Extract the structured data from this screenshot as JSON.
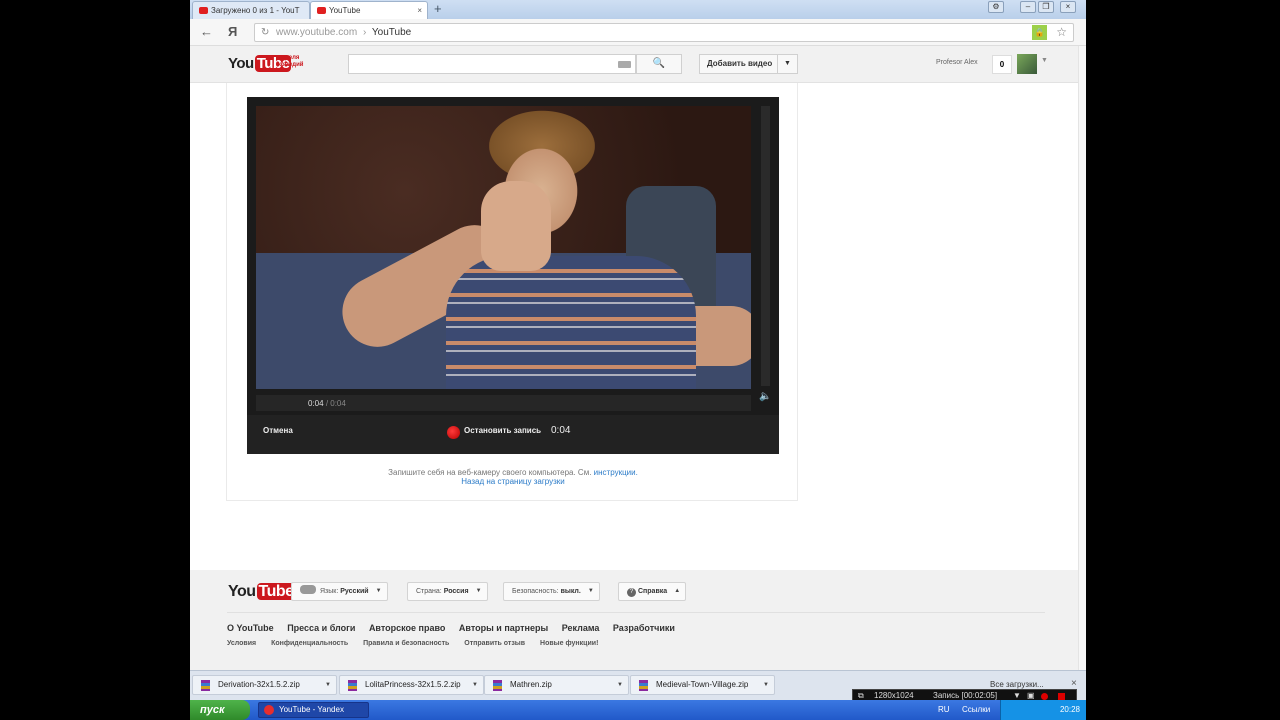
{
  "browser": {
    "tabs": [
      {
        "label": "Загружено 0 из 1 - YouT",
        "active": false
      },
      {
        "label": "YouTube",
        "active": true
      }
    ],
    "url_domain": "www.youtube.com",
    "url_separator": "›",
    "page_title": "YouTube"
  },
  "header": {
    "logo_you": "You",
    "logo_tube": "Tube",
    "logo_subtitle_line1": "неделя",
    "logo_subtitle_line2": "комедий",
    "search_placeholder": "",
    "add_video_label": "Добавить видео",
    "username": "Profesor Alex",
    "notifications_count": "0"
  },
  "recorder_player": {
    "current_time": "0:04",
    "duration": "/ 0:04",
    "cancel_label": "Отмена",
    "stop_label": "Остановить запись",
    "rec_time": "0:04"
  },
  "caption": {
    "text": "Запишите себя на веб-камеру своего компьютера. См. ",
    "instructions_link": "инструкции.",
    "back_link": "Назад на страницу загрузки"
  },
  "footer": {
    "logo_you": "You",
    "logo_tube": "Tube",
    "language_label": "Язык:",
    "language_value": "Русский",
    "country_label": "Страна:",
    "country_value": "Россия",
    "safety_label": "Безопасность:",
    "safety_value": "выкл.",
    "help_label": "Справка",
    "links": [
      "О YouTube",
      "Пресса и блоги",
      "Авторское право",
      "Авторы и партнеры",
      "Реклама",
      "Разработчики"
    ],
    "links_secondary": [
      "Условия",
      "Конфиденциальность",
      "Правила и безопасность",
      "Отправить отзыв",
      "Новые функции!"
    ]
  },
  "downloads": {
    "items": [
      "Derivation-32x1.5.2.zip",
      "LolitaPrincess-32x1.5.2.zip",
      "Mathren.zip",
      "Medieval-Town-Village.zip"
    ],
    "all_label": "Все загрузки..."
  },
  "screen_recorder": {
    "resolution": "1280x1024",
    "status": "Запись [00:02:05]"
  },
  "taskbar": {
    "start_label": "пуск",
    "active_task": "YouTube - Yandex",
    "language": "RU",
    "links_label": "Ссылки",
    "clock": "20:28"
  },
  "icons": {
    "back": "back-arrow-icon",
    "yandex": "yandex-icon",
    "reload": "reload-icon",
    "lock": "lock-icon",
    "star": "star-icon",
    "search": "search-icon",
    "volume": "volume-icon",
    "record": "record-dot-icon"
  },
  "colors": {
    "brand_red": "#cc181e",
    "link_blue": "#2b7bc8",
    "record_red": "#e02020",
    "xp_taskbar": "#2159c9",
    "xp_start": "#2f8a2a"
  }
}
